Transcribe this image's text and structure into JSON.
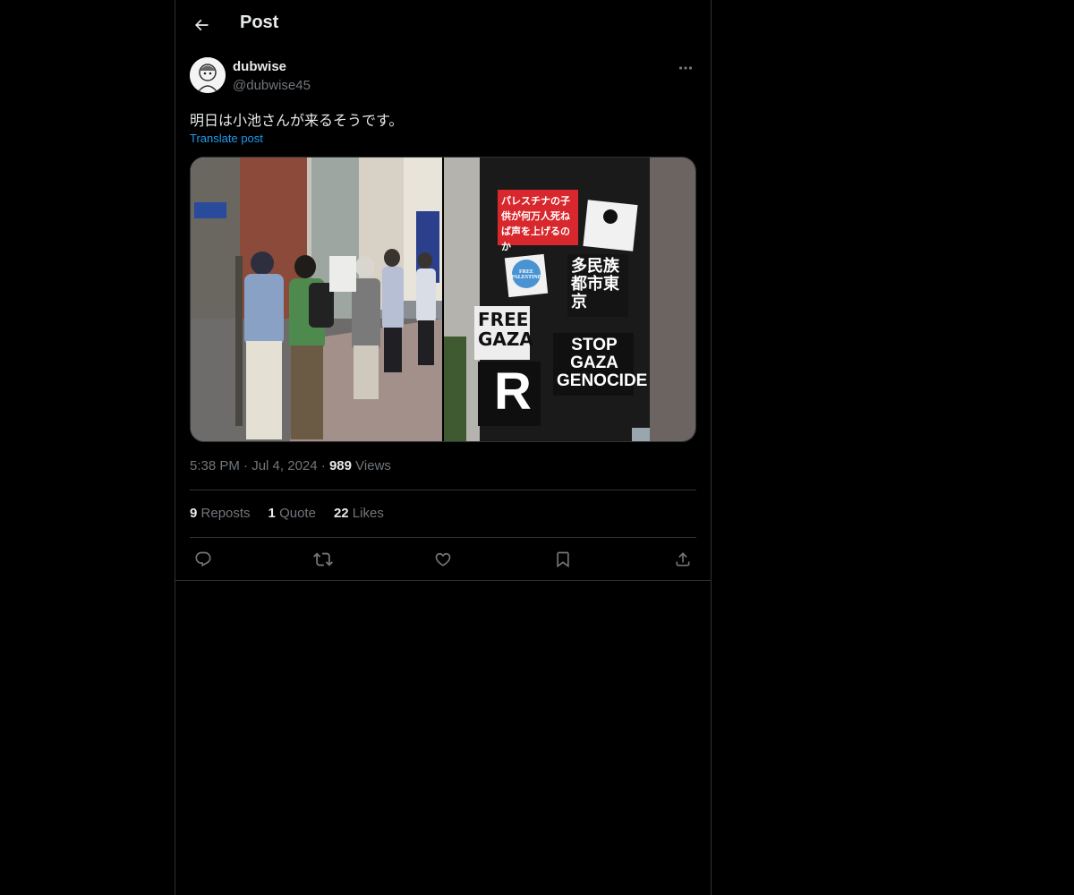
{
  "header": {
    "title": "Post"
  },
  "author": {
    "display_name": "dubwise",
    "handle": "@dubwise45"
  },
  "post": {
    "text": "明日は小池さんが来るそうです。",
    "translate_label": "Translate post"
  },
  "media": {
    "photo_right_stickers": {
      "red_sticker": "パレスチナの子供が何万人死ねば声を上げるのか",
      "free_palestine": "FREE PALESTINE",
      "tokyo": "多民族都市東京",
      "free_gaza": "FREE GAZA",
      "stop_gaza": "STOP GAZA GENOCIDE",
      "r_letter": "R"
    }
  },
  "meta": {
    "time": "5:38 PM",
    "date": "Jul 4, 2024",
    "views_count": "989",
    "views_label": "Views"
  },
  "stats": {
    "reposts_count": "9",
    "reposts_label": "Reposts",
    "quote_count": "1",
    "quote_label": "Quote",
    "likes_count": "22",
    "likes_label": "Likes"
  },
  "colors": {
    "accent": "#1d9bf0",
    "background": "#000000",
    "border": "#2f3336",
    "muted": "#71767b",
    "text": "#e7e9ea"
  },
  "icons": [
    "back-arrow-icon",
    "more-icon",
    "reply-icon",
    "repost-icon",
    "like-icon",
    "bookmark-icon",
    "share-icon"
  ]
}
